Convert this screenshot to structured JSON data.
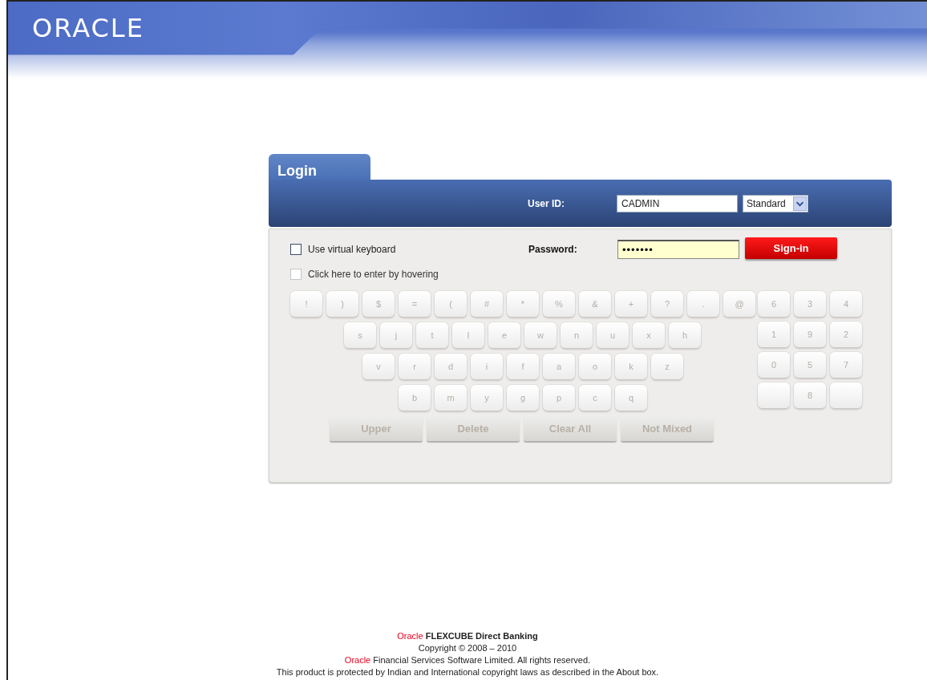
{
  "header": {
    "logo": "ORACLE"
  },
  "login": {
    "tab": "Login",
    "user_id": {
      "label": "User ID:",
      "value": "CADMIN"
    },
    "mode_select": {
      "value": "Standard"
    },
    "password": {
      "label": "Password:",
      "value": "•••••••"
    },
    "sign_in": "Sign-in",
    "options": [
      {
        "label": "Use virtual keyboard",
        "checked": false,
        "disabled": false
      },
      {
        "label": "Click here to enter by hovering",
        "checked": false,
        "disabled": true
      }
    ],
    "keyboard": {
      "rows": [
        {
          "keys": [
            "!",
            ")",
            "$",
            "=",
            "(",
            "#",
            "*",
            "%",
            "&",
            "+",
            "?",
            ".",
            "@"
          ]
        },
        {
          "keys": [
            "s",
            "j",
            "t",
            "l",
            "e",
            "w",
            "n",
            "u",
            "x",
            "h"
          ]
        },
        {
          "keys": [
            "v",
            "r",
            "d",
            "i",
            "f",
            "a",
            "o",
            "k",
            "z"
          ]
        },
        {
          "keys": [
            "b",
            "m",
            "y",
            "g",
            "p",
            "c",
            "q"
          ]
        }
      ],
      "numpad": [
        [
          {
            "kind": "key",
            "label": "6"
          },
          {
            "kind": "key",
            "label": "3"
          },
          {
            "kind": "key",
            "label": "4"
          }
        ],
        [
          {
            "kind": "key",
            "label": "1"
          },
          {
            "kind": "key",
            "label": "9"
          },
          {
            "kind": "key",
            "label": "2"
          }
        ],
        [
          {
            "kind": "key",
            "label": "0"
          },
          {
            "kind": "key",
            "label": "5"
          },
          {
            "kind": "key",
            "label": "7"
          }
        ],
        [
          {
            "kind": "blank"
          },
          {
            "kind": "key",
            "label": "8"
          },
          {
            "kind": "blank"
          }
        ]
      ],
      "actions": [
        "Upper",
        "Delete",
        "Clear All",
        "Not Mixed"
      ]
    }
  },
  "footer": [
    {
      "brand": "Oracle",
      "text": "FLEXCUBE Direct Banking",
      "bold": true
    },
    {
      "text": "Copyright © 2008 – 2010",
      "bold": false
    },
    {
      "brand": "Oracle",
      "text": "Financial Services Software Limited. All rights reserved.",
      "bold": false
    },
    {
      "text": "This product is protected by Indian and International copyright laws as described in the About box.",
      "bold": false
    }
  ]
}
